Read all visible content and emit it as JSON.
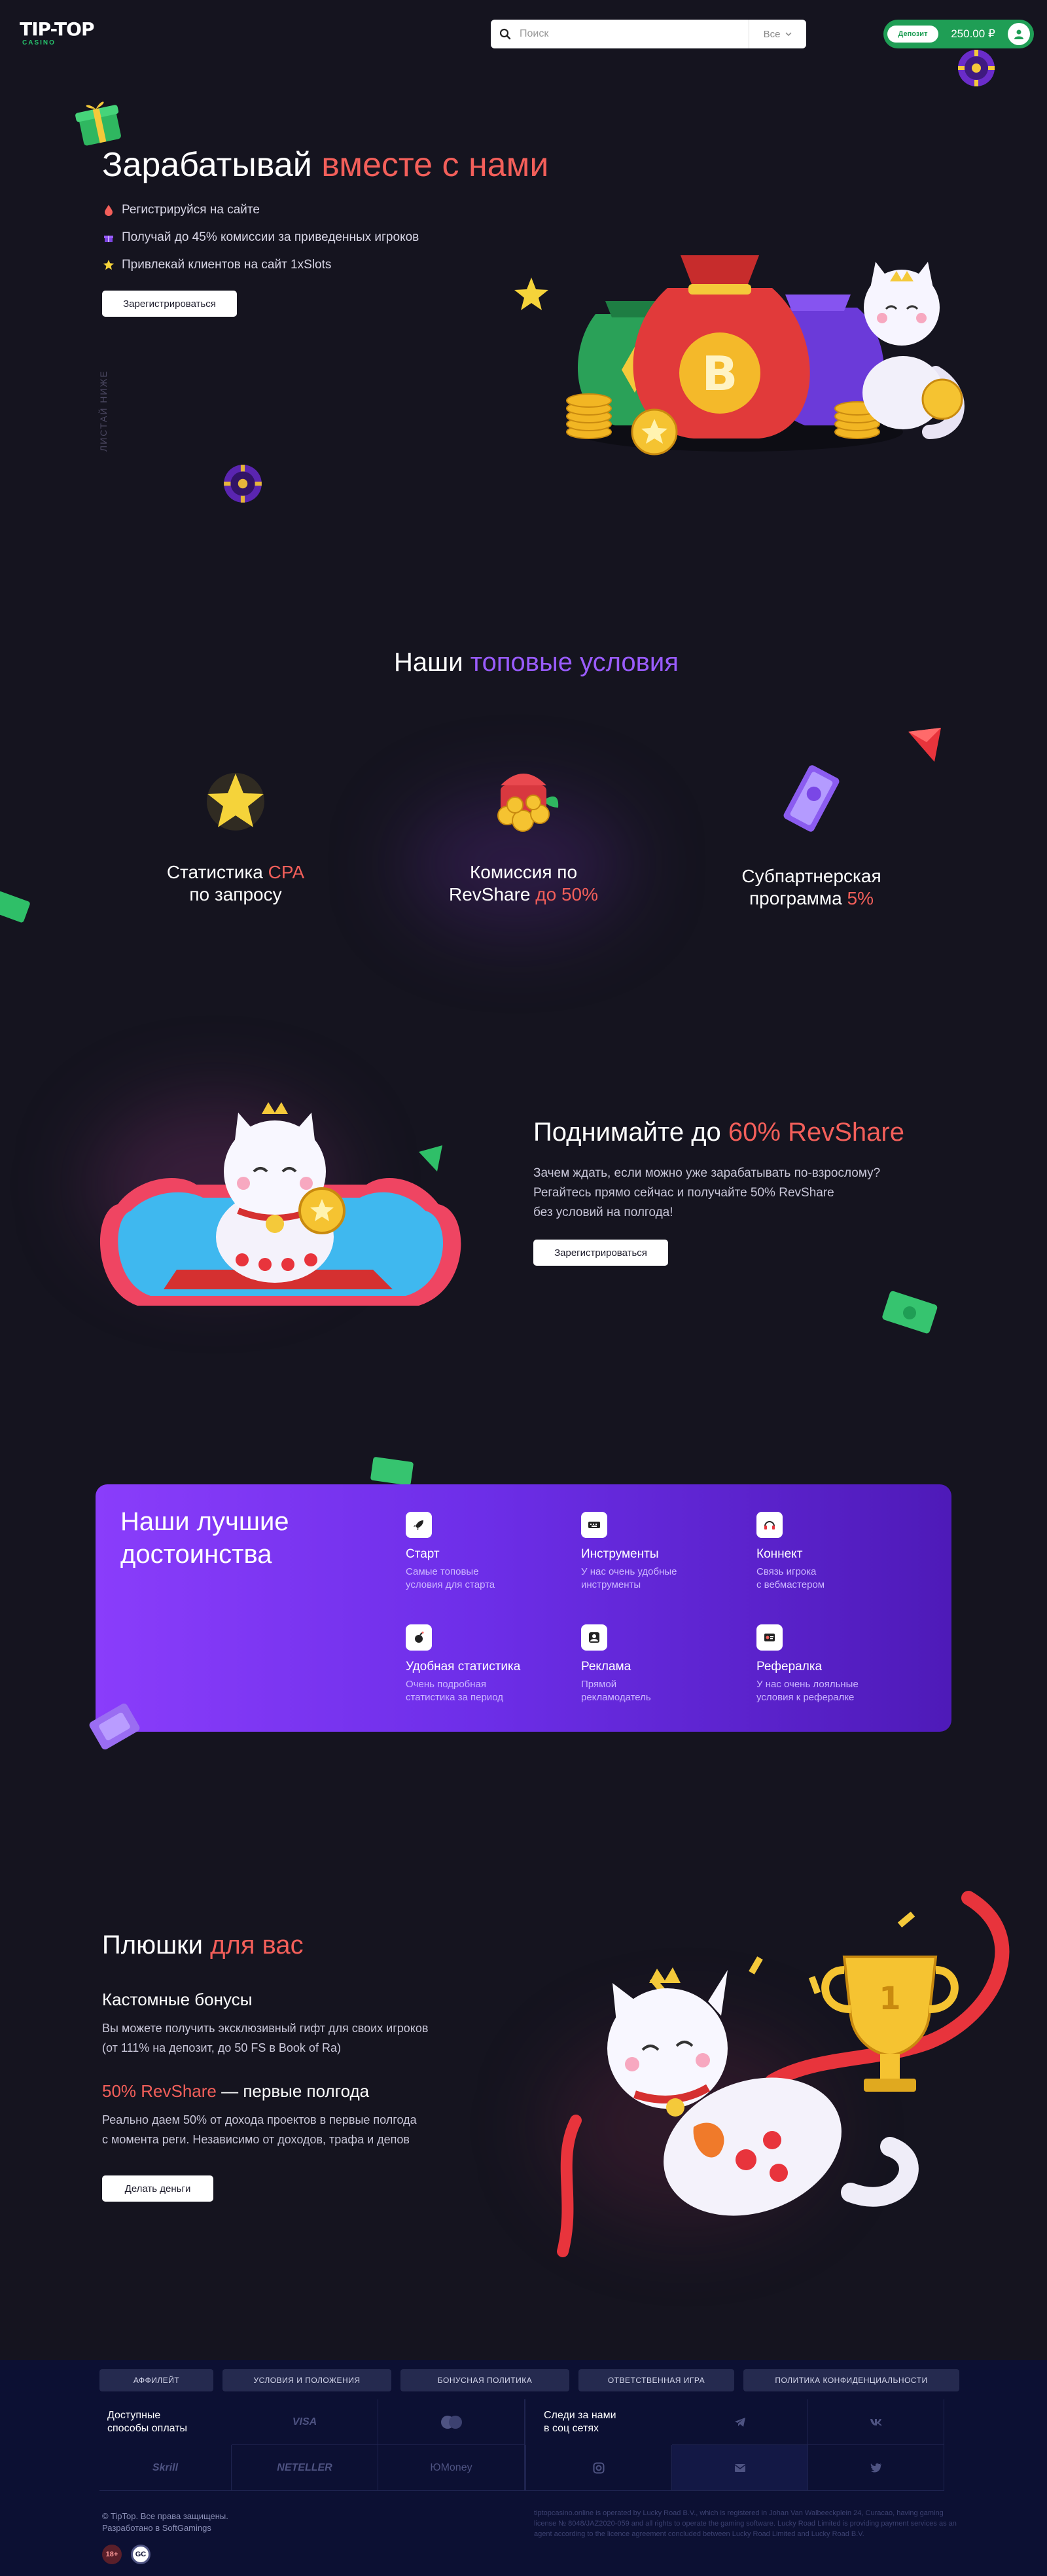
{
  "header": {
    "logo_main": "TIP-TOP",
    "logo_sub": "CASINO",
    "search_placeholder": "Поиск",
    "search_filter": "Все",
    "deposit_label": "Депозит",
    "balance": "250.00 ₽"
  },
  "hero": {
    "title_plain": "Зарабатывай",
    "title_accent": "вместе с нами",
    "items": [
      {
        "icon": "drop-icon",
        "text": "Регистрируйся на сайте"
      },
      {
        "icon": "gift-icon",
        "text": "Получай до 45% комиссии за приведенных игроков"
      },
      {
        "icon": "star-icon",
        "text": "Привлекай клиентов на сайт 1xSlots"
      }
    ],
    "button": "Зарегистрироваться",
    "scroll_hint": "ЛИСТАЙ НИЖЕ"
  },
  "conditions": {
    "title_plain": "Наши",
    "title_accent": "топовые условия",
    "cards": [
      {
        "line1": "Статистика",
        "line1_accent": "CPA",
        "line2": "по запросу",
        "line2_accent": ""
      },
      {
        "line1": "Комиссия по",
        "line1_accent": "",
        "line2": "RevShare",
        "line2_accent": "до 50%"
      },
      {
        "line1": "Субпартнерская",
        "line1_accent": "",
        "line2": "программа",
        "line2_accent": "5%"
      }
    ]
  },
  "revshare": {
    "title_plain": "Поднимайте до",
    "title_accent": "60% RevShare",
    "text_lines": [
      "Зачем ждать, если можно уже зарабатывать по-взрослому?",
      "Регайтесь прямо сейчас и получайте 50% RevShare",
      "без условий на полгода!"
    ],
    "button": "Зарегистрироваться"
  },
  "advantages": {
    "title_line1": "Наши лучшие",
    "title_line2": "достоинства",
    "items": [
      {
        "icon": "rocket-icon",
        "name": "Старт",
        "desc1": "Самые топовые",
        "desc2": "условия для старта"
      },
      {
        "icon": "keyboard-icon",
        "name": "Инструменты",
        "desc1": "У нас очень удобные",
        "desc2": "инструменты"
      },
      {
        "icon": "headset-icon",
        "name": "Коннект",
        "desc1": "Связь игрока",
        "desc2": "с вебмастером"
      },
      {
        "icon": "bomb-icon",
        "name": "Удобная статистика",
        "desc1": "Очень подробная",
        "desc2": "статистика за период"
      },
      {
        "icon": "person-icon",
        "name": "Реклама",
        "desc1": "Прямой",
        "desc2": "рекламодатель"
      },
      {
        "icon": "referral-icon",
        "name": "Рефералка",
        "desc1": "У нас очень лояльные",
        "desc2": "условия к рефералке"
      }
    ]
  },
  "bonuses": {
    "title_plain": "Плюшки",
    "title_accent": "для вас",
    "h1": "Кастомные бонусы",
    "p1_line1": "Вы можете получить эксклюзивный гифт для своих игроков",
    "p1_line2": "(от 111% на депозит, до 50 FS в Book of Ra)",
    "h2_accent": "50% RevShare",
    "h2_plain": "— первые полгода",
    "p2_line1": "Реально даем 50% от дохода проектов в первые полгода",
    "p2_line2": "с момента реги. Независимо от доходов, трафа и депов",
    "button": "Делать деньги"
  },
  "footer": {
    "links": [
      "АФФИЛЕЙТ",
      "УСЛОВИЯ И ПОЛОЖЕНИЯ",
      "БОНУСНАЯ ПОЛИТИКА",
      "ОТВЕТСТВЕННАЯ ИГРА",
      "ПОЛИТИКА КОНФИДЕНЦИАЛЬНОСТИ"
    ],
    "payments_label_1": "Доступные",
    "payments_label_2": "способы оплаты",
    "payments": [
      "VISA",
      "mastercard",
      "Skrill",
      "NETELLER",
      "ЮMoney"
    ],
    "social_label_1": "Следи за нами",
    "social_label_2": "в соц сетях",
    "socials": [
      "telegram-icon",
      "vk-icon",
      "instagram-icon",
      "email-icon",
      "twitter-icon"
    ],
    "copyright_1": "© TipTop. Все права защищены.",
    "copyright_2": "Разработано в SoftGamings",
    "legal": "tiptopcasino.online is operated by Lucky Road B.V., which is registered in Johan Van Walbeeckplein 24, Curacao, having gaming license № 8048/JAZ2020-059 and all rights to operate the gaming software. Lucky Road Limited is providing payment services as an agent according to the licence agreement concluded between Lucky Road Limited and Lucky Road B.V.",
    "badge_age": "18+",
    "badge_license": "GC"
  },
  "colors": {
    "accent_red": "#f35f5a",
    "accent_purple": "#9a5cff",
    "brand_green": "#1f9e55",
    "footer_bg": "#0c1033"
  }
}
